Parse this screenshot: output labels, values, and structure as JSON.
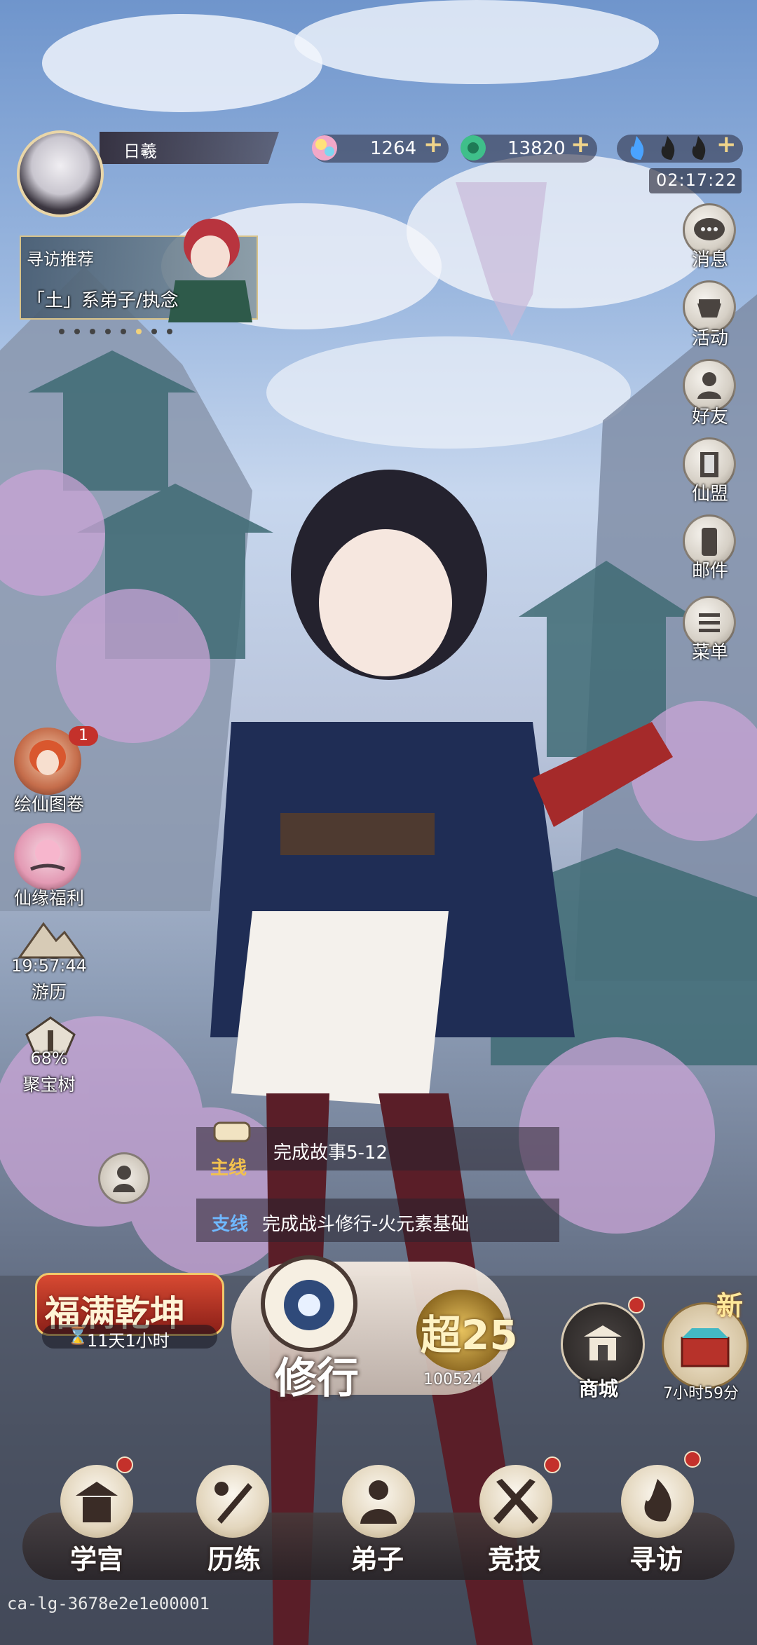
{
  "player": {
    "name": "日羲"
  },
  "resources": [
    {
      "icon": "spirit-gem-icon",
      "value": "1264"
    },
    {
      "icon": "jade-coin-icon",
      "value": "13820"
    }
  ],
  "stamina_flames": {
    "icon": "flame-icon",
    "filled": 1,
    "total": 3
  },
  "timer": "02:17:22",
  "recommend": {
    "title": "寻访推荐",
    "subtitle": "「土」系弟子/执念",
    "dots": 8,
    "active_dot": 6
  },
  "right_menu": [
    {
      "label": "消息",
      "icon": "chat-bubble-icon"
    },
    {
      "label": "活动",
      "icon": "teacup-icon"
    },
    {
      "label": "好友",
      "icon": "friends-icon"
    },
    {
      "label": "仙盟",
      "icon": "banner-icon"
    },
    {
      "label": "邮件",
      "icon": "mail-icon"
    },
    {
      "label": "菜单",
      "icon": "menu-icon"
    }
  ],
  "left_menu": [
    {
      "label": "绘仙图卷",
      "badge": "1",
      "icon": "portrait-icon"
    },
    {
      "label": "仙缘福利",
      "icon": "blossom-icon"
    },
    {
      "label": "游历",
      "timer": "19:57:44",
      "icon": "mountain-icon"
    },
    {
      "label": "聚宝树",
      "progress": "68%",
      "icon": "treasure-tree-icon"
    }
  ],
  "quests": {
    "main": {
      "tag": "主线",
      "text": "完成故事5-12"
    },
    "side": {
      "tag": "支线",
      "text": "完成战斗修行-火元素基础"
    }
  },
  "event_banner": {
    "title": "福满乾坤",
    "countdown": "11天1小时"
  },
  "cultivate": {
    "label": "修行",
    "tier": "超25",
    "power": "100524"
  },
  "shop": {
    "label": "商城"
  },
  "new_item": {
    "badge": "新",
    "countdown": "7小时59分"
  },
  "nav": [
    {
      "label": "学宫",
      "icon": "academy-icon"
    },
    {
      "label": "历练",
      "icon": "training-icon"
    },
    {
      "label": "弟子",
      "icon": "disciple-icon"
    },
    {
      "label": "竞技",
      "icon": "crossed-swords-icon"
    },
    {
      "label": "寻访",
      "icon": "flame-search-icon"
    }
  ],
  "footer_id": "ca-lg-3678e2e1e00001",
  "colors": {
    "gold": "#f0d48a",
    "red_dot": "#c4312b",
    "main_tag": "#f2c14e",
    "side_tag": "#6fb8ff"
  }
}
